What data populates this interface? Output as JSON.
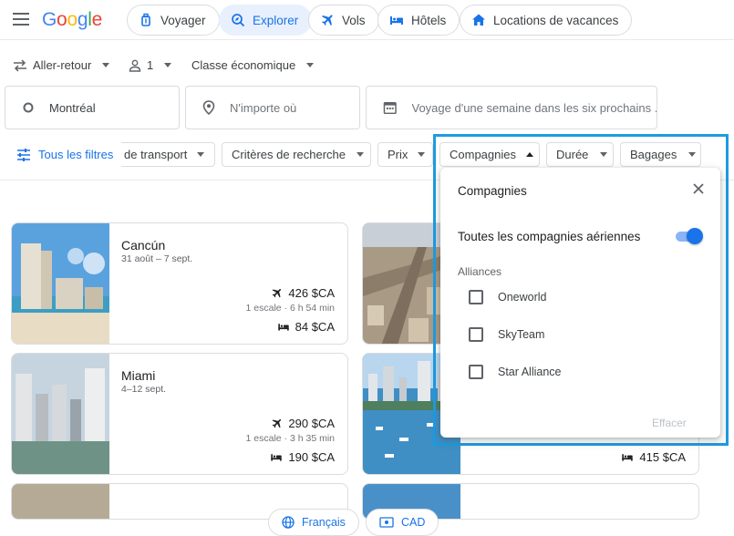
{
  "header": {
    "logo": [
      "G",
      "o",
      "o",
      "g",
      "l",
      "e"
    ],
    "nav": [
      {
        "label": "Voyager",
        "icon": "luggage-icon"
      },
      {
        "label": "Explorer",
        "icon": "explore-icon",
        "active": true
      },
      {
        "label": "Vols",
        "icon": "plane-icon"
      },
      {
        "label": "Hôtels",
        "icon": "bed-icon"
      },
      {
        "label": "Locations de vacances",
        "icon": "house-icon"
      }
    ]
  },
  "options": {
    "trip_type": "Aller-retour",
    "passengers": "1",
    "cabin_class": "Classe économique"
  },
  "search": {
    "origin": "Montréal",
    "destination_placeholder": "N'importe où",
    "dates_placeholder": "Voyage d'une semaine dans les six prochains ..."
  },
  "filters": {
    "all_filters": "Tous les filtres",
    "items": [
      "de transport",
      "Critères de recherche",
      "Prix",
      "Compagnies",
      "Durée",
      "Bagages"
    ]
  },
  "results": [
    {
      "city": "Cancún",
      "dates": "31 août – 7 sept.",
      "flight_price": "426 $CA",
      "stops": "1 escale · 6 h 54 min",
      "hotel_price": "84 $CA"
    },
    {
      "city": "Miami",
      "dates": "4–12 sept.",
      "flight_price": "290 $CA",
      "stops": "1 escale · 3 h 35 min",
      "hotel_price": "190 $CA"
    },
    {
      "hotel_price": "415 $CA"
    }
  ],
  "dropdown": {
    "title": "Compagnies",
    "all_airlines": "Toutes les compagnies aériennes",
    "all_airlines_on": true,
    "alliances_label": "Alliances",
    "alliances": [
      "Oneworld",
      "SkyTeam",
      "Star Alliance"
    ],
    "clear": "Effacer"
  },
  "footer": {
    "language": "Français",
    "currency": "CAD"
  },
  "colors": {
    "accent": "#1a73e8",
    "highlight": "#1e9be0"
  }
}
